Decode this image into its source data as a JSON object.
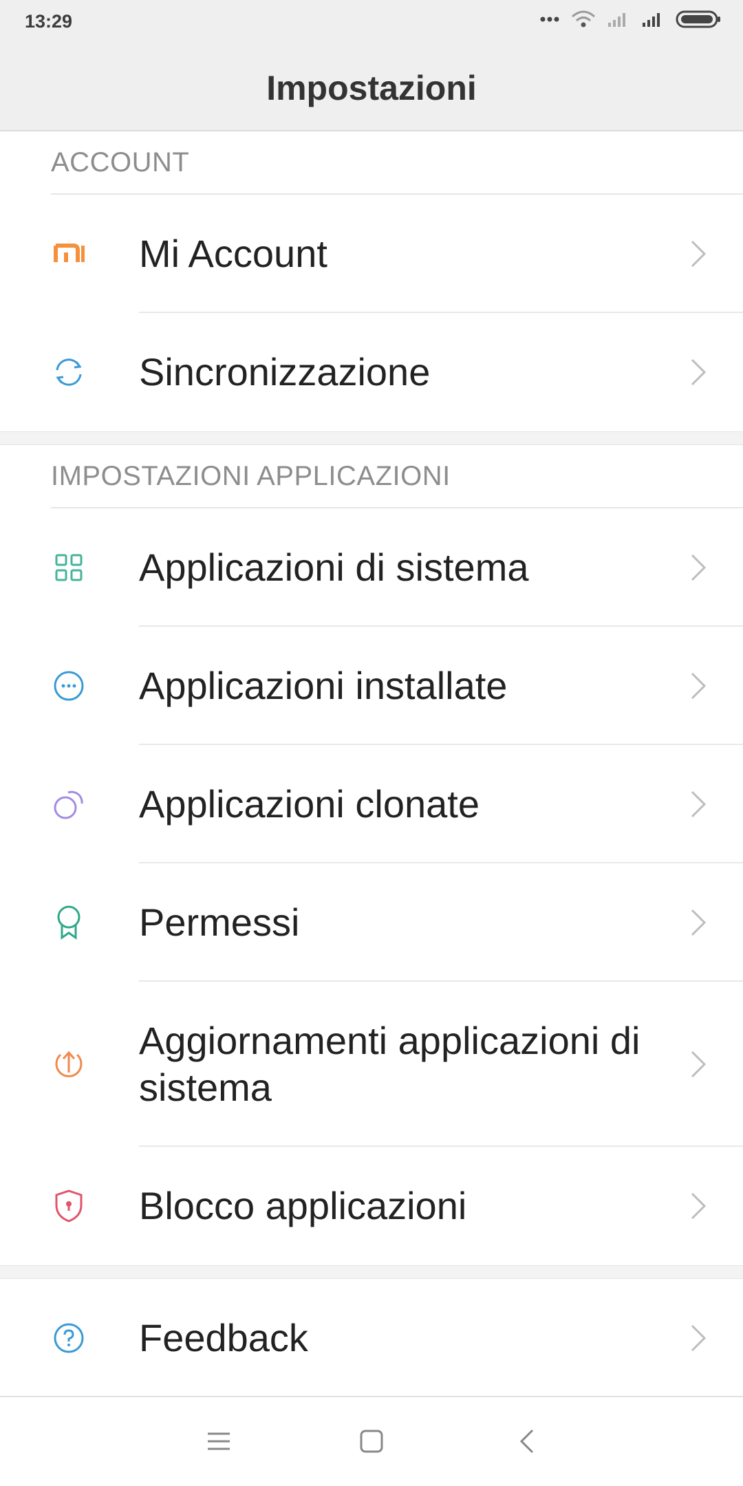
{
  "status": {
    "time": "13:29",
    "icons": [
      "dots-icon",
      "wifi-icon",
      "signal-icon",
      "signal-icon",
      "battery-icon"
    ]
  },
  "header": {
    "title": "Impostazioni"
  },
  "sections": [
    {
      "title": "ACCOUNT",
      "items": [
        {
          "label": "Mi Account",
          "icon": "mi-logo-icon",
          "color": "#f5913c"
        },
        {
          "label": "Sincronizzazione",
          "icon": "sync-icon",
          "color": "#3a9ad6"
        }
      ]
    },
    {
      "title": "IMPOSTAZIONI APPLICAZIONI",
      "items": [
        {
          "label": "Applicazioni di sistema",
          "icon": "grid-icon",
          "color": "#46b39a"
        },
        {
          "label": "Applicazioni installate",
          "icon": "more-circle-icon",
          "color": "#3a9ad6"
        },
        {
          "label": "Applicazioni clonate",
          "icon": "clone-icon",
          "color": "#a58be0"
        },
        {
          "label": "Permessi",
          "icon": "badge-icon",
          "color": "#2fa889"
        },
        {
          "label": "Aggiornamenti applicazioni di sistema",
          "icon": "upload-icon",
          "color": "#f08a4b"
        },
        {
          "label": "Blocco applicazioni",
          "icon": "shield-lock-icon",
          "color": "#e0556b"
        }
      ]
    },
    {
      "title": "",
      "items": [
        {
          "label": "Feedback",
          "icon": "help-icon",
          "color": "#3a9ad6"
        }
      ]
    }
  ],
  "navbar": {
    "buttons": [
      "menu-icon",
      "home-icon",
      "back-icon"
    ]
  }
}
